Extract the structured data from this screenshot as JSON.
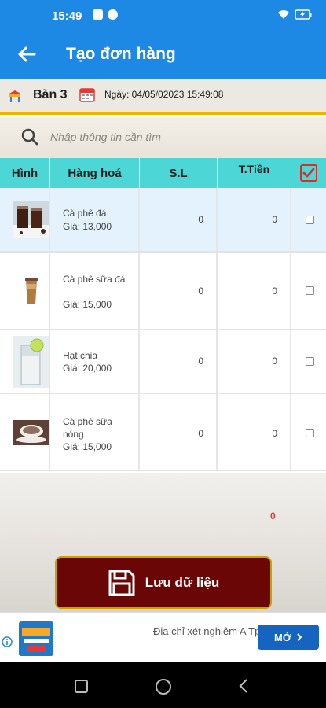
{
  "status": {
    "time": "15:49"
  },
  "app": {
    "title": "Tạo đơn hàng"
  },
  "info": {
    "table": "Bàn 3",
    "date": "Ngày: 04/05/02023 15:49:08"
  },
  "search": {
    "placeholder": "Nhập thông tin cần tìm"
  },
  "columns": {
    "image": "Hình",
    "item": "Hàng hoá",
    "qty": "S.L",
    "total": "T.Tiền"
  },
  "items": [
    {
      "name": "Cà phê đá",
      "price": "Giá: 13,000",
      "qty": "0",
      "total": "0"
    },
    {
      "name": "Cà phê sữa đá",
      "price": "Giá: 15,000",
      "qty": "0",
      "total": "0"
    },
    {
      "name": "Hạt chia",
      "price": "Giá: 20,000",
      "qty": "0",
      "total": "0"
    },
    {
      "name": "Cà phê sữa nóng",
      "price": "Giá: 15,000",
      "qty": "0",
      "total": "0"
    }
  ],
  "summary": {
    "total": "0"
  },
  "save": {
    "label": "Lưu dữ liệu"
  },
  "ad": {
    "text": "Địa chỉ xét nghiệm A TpHCM",
    "button": "MỞ"
  }
}
